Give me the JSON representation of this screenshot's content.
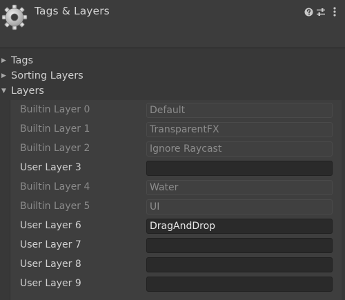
{
  "header": {
    "title": "Tags & Layers",
    "icons": [
      "gear-icon",
      "help-icon",
      "presets-icon",
      "kebab-menu-icon"
    ]
  },
  "foldouts": [
    {
      "label": "Tags",
      "expanded": false
    },
    {
      "label": "Sorting Layers",
      "expanded": false
    },
    {
      "label": "Layers",
      "expanded": true
    }
  ],
  "layers": [
    {
      "label": "Builtin Layer 0",
      "value": "Default",
      "editable": false
    },
    {
      "label": "Builtin Layer 1",
      "value": "TransparentFX",
      "editable": false
    },
    {
      "label": "Builtin Layer 2",
      "value": "Ignore Raycast",
      "editable": false
    },
    {
      "label": "User Layer 3",
      "value": "",
      "editable": true
    },
    {
      "label": "Builtin Layer 4",
      "value": "Water",
      "editable": false
    },
    {
      "label": "Builtin Layer 5",
      "value": "UI",
      "editable": false
    },
    {
      "label": "User Layer 6",
      "value": "DragAndDrop",
      "editable": true
    },
    {
      "label": "User Layer 7",
      "value": "",
      "editable": true
    },
    {
      "label": "User Layer 8",
      "value": "",
      "editable": true
    },
    {
      "label": "User Layer 9",
      "value": "",
      "editable": true
    }
  ],
  "colors": {
    "background": "#383838",
    "header": "#3c3c3c",
    "editable_field": "#2a2a2a",
    "readonly_text": "#8a8a8a"
  }
}
